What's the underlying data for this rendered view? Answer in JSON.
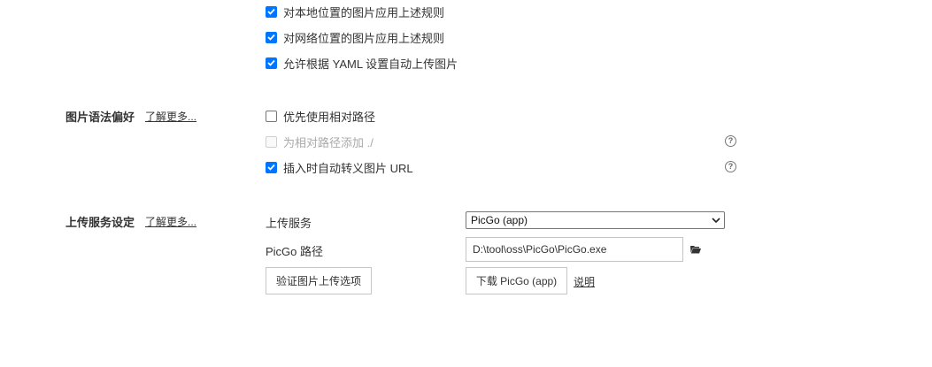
{
  "image_rules": {
    "local_label": "对本地位置的图片应用上述规则",
    "network_label": "对网络位置的图片应用上述规则",
    "yaml_label": "允许根据 YAML 设置自动上传图片"
  },
  "syntax_prefs": {
    "title": "图片语法偏好",
    "learn_more": "了解更多...",
    "relative_path_label": "优先使用相对路径",
    "add_dot_slash_label": "为相对路径添加 ./",
    "escape_url_label": "插入时自动转义图片 URL",
    "help_glyph": "?"
  },
  "upload_service": {
    "title": "上传服务设定",
    "learn_more": "了解更多...",
    "service_label": "上传服务",
    "service_value": "PicGo (app)",
    "path_label": "PicGo 路径",
    "path_value": "D:\\tool\\oss\\PicGo\\PicGo.exe",
    "verify_button": "验证图片上传选项",
    "download_button": "下载 PicGo (app)",
    "explain_link": "说明"
  },
  "accent_color": "#0075ff"
}
